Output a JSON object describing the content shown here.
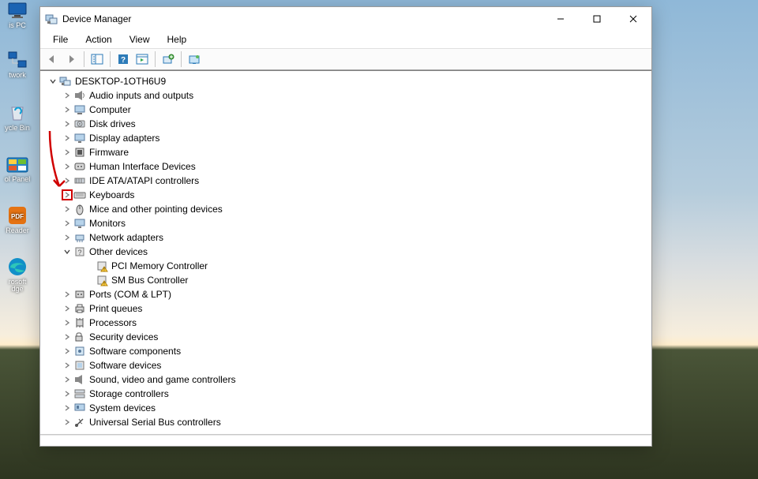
{
  "desktop": {
    "items": [
      {
        "label": "is PC",
        "icon": "pc"
      },
      {
        "label": "twork",
        "icon": "network"
      },
      {
        "label": "ycle Bin",
        "icon": "recycle"
      },
      {
        "label": "ol Panel",
        "icon": "control-panel"
      },
      {
        "label": "Reader",
        "icon": "pdf"
      },
      {
        "label": "rosoft dge",
        "icon": "edge"
      }
    ]
  },
  "window": {
    "title": "Device Manager"
  },
  "menu": {
    "items": [
      {
        "label": "File"
      },
      {
        "label": "Action"
      },
      {
        "label": "View"
      },
      {
        "label": "Help"
      }
    ]
  },
  "tree": {
    "root": {
      "label": "DESKTOP-1OTH6U9",
      "expanded": "down"
    },
    "categories": [
      {
        "label": "Audio inputs and outputs",
        "icon": "audio",
        "expand": "right"
      },
      {
        "label": "Computer",
        "icon": "computer",
        "expand": "right"
      },
      {
        "label": "Disk drives",
        "icon": "disk",
        "expand": "right"
      },
      {
        "label": "Display adapters",
        "icon": "display",
        "expand": "right"
      },
      {
        "label": "Firmware",
        "icon": "firmware",
        "expand": "right"
      },
      {
        "label": "Human Interface Devices",
        "icon": "hid",
        "expand": "right"
      },
      {
        "label": "IDE ATA/ATAPI controllers",
        "icon": "ide",
        "expand": "right"
      },
      {
        "label": "Keyboards",
        "icon": "keyboard",
        "expand": "right",
        "highlight": true
      },
      {
        "label": "Mice and other pointing devices",
        "icon": "mouse",
        "expand": "right"
      },
      {
        "label": "Monitors",
        "icon": "monitor",
        "expand": "right"
      },
      {
        "label": "Network adapters",
        "icon": "net",
        "expand": "right"
      },
      {
        "label": "Other devices",
        "icon": "other",
        "expand": "down",
        "children": [
          {
            "label": "PCI Memory Controller",
            "icon": "warn"
          },
          {
            "label": "SM Bus Controller",
            "icon": "warn"
          }
        ]
      },
      {
        "label": "Ports (COM & LPT)",
        "icon": "ports",
        "expand": "right"
      },
      {
        "label": "Print queues",
        "icon": "print",
        "expand": "right"
      },
      {
        "label": "Processors",
        "icon": "cpu",
        "expand": "right"
      },
      {
        "label": "Security devices",
        "icon": "security",
        "expand": "right"
      },
      {
        "label": "Software components",
        "icon": "swc",
        "expand": "right"
      },
      {
        "label": "Software devices",
        "icon": "swd",
        "expand": "right"
      },
      {
        "label": "Sound, video and game controllers",
        "icon": "sound",
        "expand": "right"
      },
      {
        "label": "Storage controllers",
        "icon": "storage",
        "expand": "right"
      },
      {
        "label": "System devices",
        "icon": "system",
        "expand": "right"
      },
      {
        "label": "Universal Serial Bus controllers",
        "icon": "usb",
        "expand": "right"
      }
    ]
  },
  "icons_svg_colors": {
    "border": "#5a7a9c",
    "fill": "#b7d3ea"
  }
}
